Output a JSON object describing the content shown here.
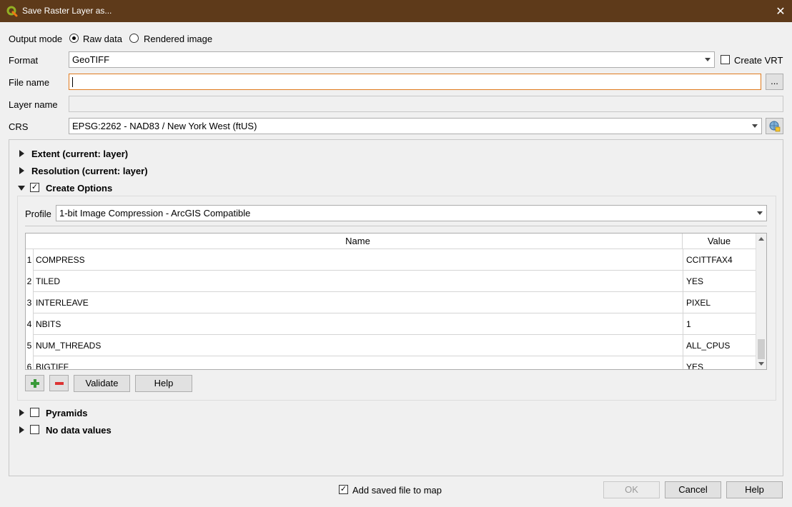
{
  "window": {
    "title": "Save Raster Layer as...",
    "close_glyph": "✕"
  },
  "output_mode": {
    "label": "Output mode",
    "options": [
      "Raw data",
      "Rendered image"
    ],
    "selected": "Raw data"
  },
  "format": {
    "label": "Format",
    "value": "GeoTIFF",
    "create_vrt_label": "Create VRT",
    "create_vrt_checked": false
  },
  "file_name": {
    "label": "File name",
    "value": "",
    "browse_label": "..."
  },
  "layer_name": {
    "label": "Layer name",
    "value": ""
  },
  "crs": {
    "label": "CRS",
    "value": "EPSG:2262 - NAD83 / New York West (ftUS)"
  },
  "sections": {
    "extent": "Extent (current: layer)",
    "resolution": "Resolution (current: layer)",
    "create_options": "Create Options",
    "pyramids": "Pyramids",
    "no_data": "No data values"
  },
  "create_options": {
    "checked": true,
    "profile_label": "Profile",
    "profile_value": "1-bit Image Compression - ArcGIS Compatible",
    "table": {
      "headers": [
        "Name",
        "Value"
      ],
      "rows": [
        {
          "num": "1",
          "name": "COMPRESS",
          "value": "CCITTFAX4"
        },
        {
          "num": "2",
          "name": "TILED",
          "value": "YES"
        },
        {
          "num": "3",
          "name": "INTERLEAVE",
          "value": "PIXEL"
        },
        {
          "num": "4",
          "name": "NBITS",
          "value": "1"
        },
        {
          "num": "5",
          "name": "NUM_THREADS",
          "value": "ALL_CPUS"
        },
        {
          "num": "6",
          "name": "BIGTIFF",
          "value": "YES"
        }
      ]
    },
    "validate_label": "Validate",
    "help_label": "Help"
  },
  "footer": {
    "add_to_map_label": "Add saved file to map",
    "add_to_map_checked": true,
    "ok_label": "OK",
    "cancel_label": "Cancel",
    "help_label": "Help"
  },
  "colors": {
    "titlebar": "#5e3a1a",
    "focus_border": "#e07b1f",
    "accent_green": "#3a9a3a",
    "accent_red": "#dd3333"
  }
}
